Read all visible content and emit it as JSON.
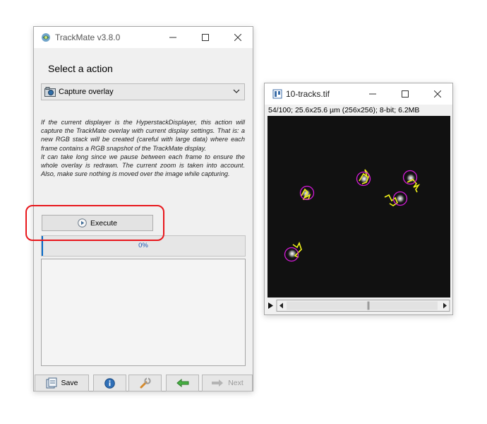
{
  "trackmate_window": {
    "title": "TrackMate v3.8.0",
    "heading": "Select a action",
    "action_dropdown": {
      "selected": "Capture overlay"
    },
    "description": [
      "If the current displayer is the HyperstackDisplayer, this action will capture the TrackMate overlay with current display settings. That is: a new RGB stack will be created (careful with large data) where each frame contains a RGB snapshot of the TrackMate display.",
      "It can take long since we pause between each frame to ensure the whole overlay is redrawn. The current zoom is taken into account. Also, make sure nothing is moved over the image while capturing."
    ],
    "execute_label": "Execute",
    "progress": {
      "value": 0,
      "text": "0%"
    },
    "footer": {
      "save_label": "Save",
      "next_label": "Next"
    }
  },
  "image_window": {
    "title": "10-tracks.tif",
    "info": "54/100; 25.6x25.6 µm (256x256); 8-bit; 6.2MB",
    "frame": 54,
    "frames_total": 100
  },
  "colors": {
    "highlight_ring": "#e8171c",
    "spot_circle": "#d21ad6",
    "track": "#f2f21a",
    "progress_text": "#1b56b5"
  }
}
